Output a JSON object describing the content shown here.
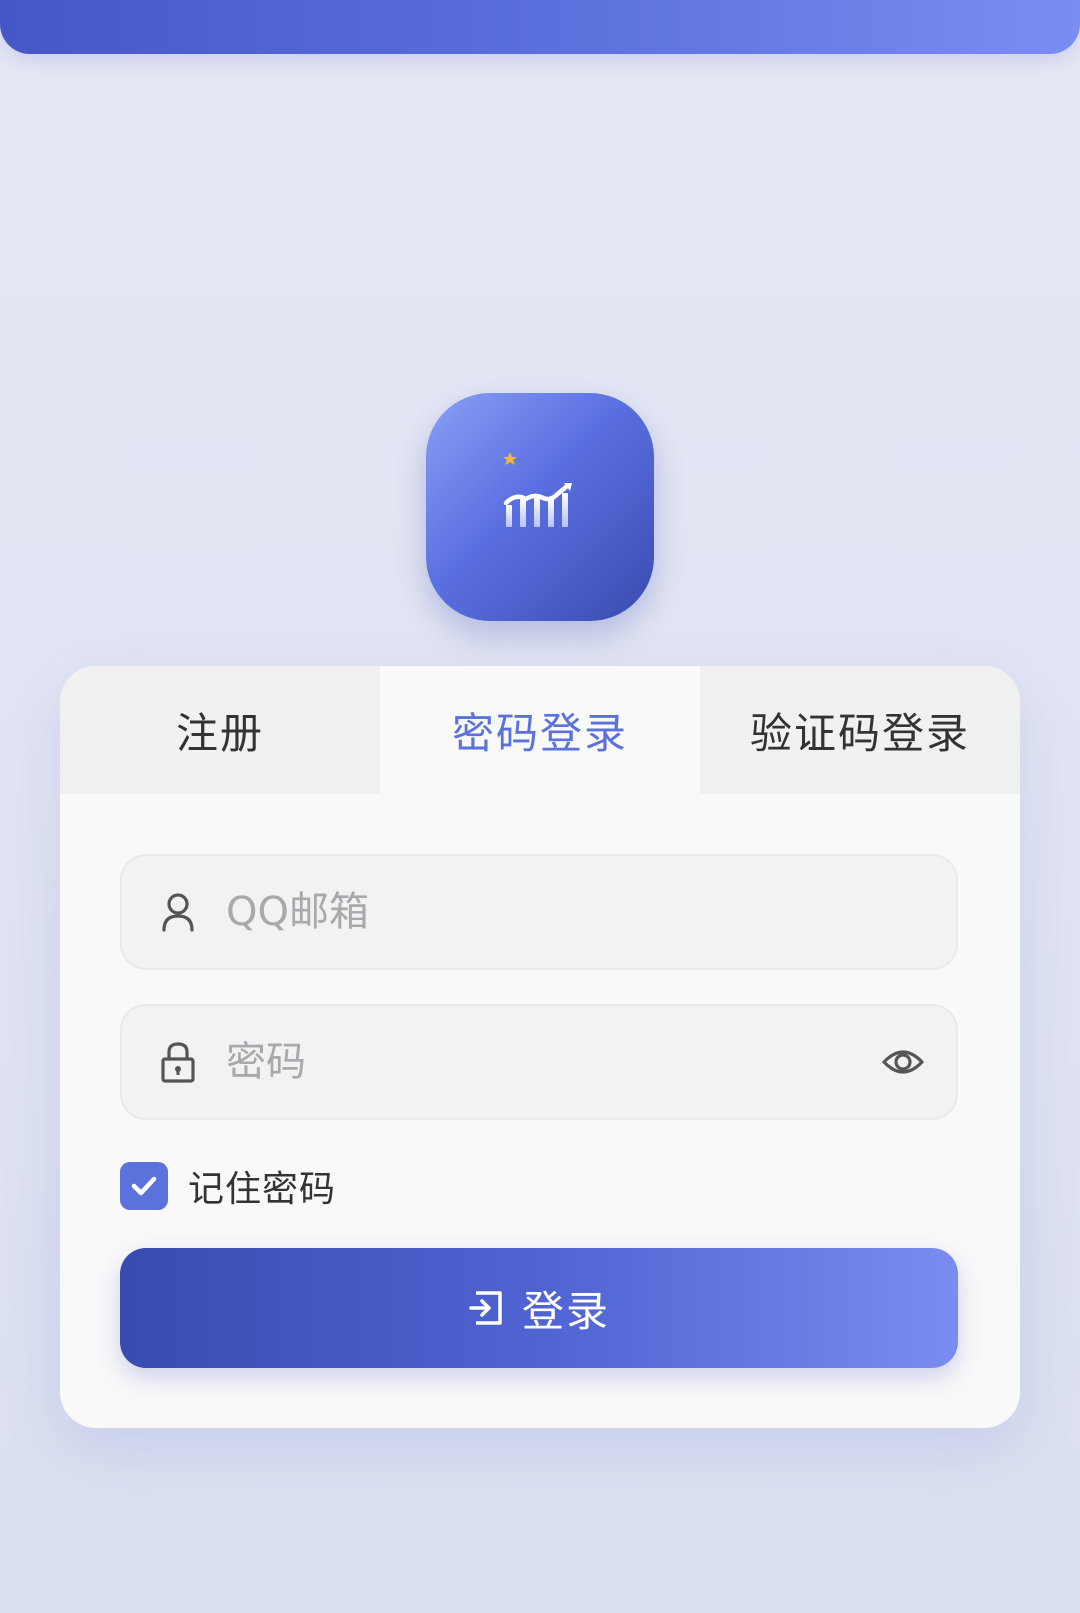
{
  "tabs": [
    {
      "label": "注册",
      "active": false
    },
    {
      "label": "密码登录",
      "active": true
    },
    {
      "label": "验证码登录",
      "active": false
    }
  ],
  "form": {
    "email_placeholder": "QQ邮箱",
    "email_value": "",
    "password_placeholder": "密码",
    "password_value": "",
    "remember_label": "记住密码",
    "remember_checked": true,
    "login_label": "登录"
  },
  "icons": {
    "logo": "chart-growth-icon",
    "email": "user-icon",
    "password": "lock-icon",
    "toggle": "eye-icon",
    "login": "login-enter-icon"
  },
  "colors": {
    "accent": "#5b72dc",
    "gradient_start": "#3a4bb0",
    "gradient_end": "#7a8cf0",
    "star": "#f4b83a"
  }
}
